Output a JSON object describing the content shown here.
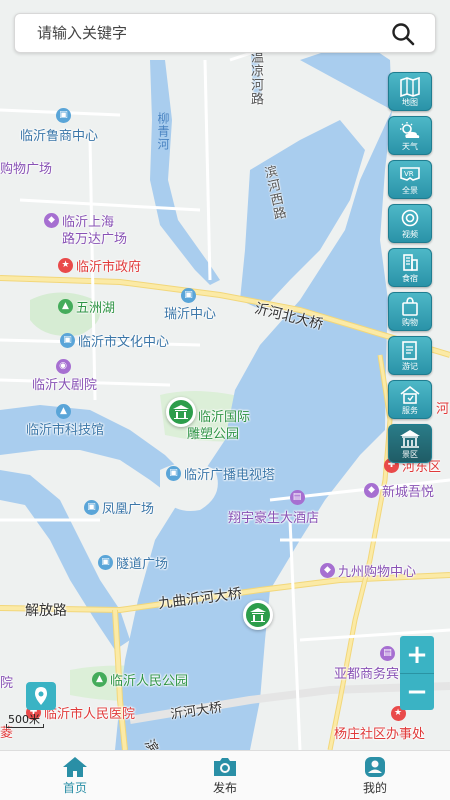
{
  "search": {
    "placeholder": "请输入关键字"
  },
  "map": {
    "pois": [
      {
        "name": "临沂鲁商中心",
        "color": "blue"
      },
      {
        "name": "购物广场",
        "color": "purple"
      },
      {
        "name": "临沂上海",
        "color": "purple"
      },
      {
        "name": "路万达广场",
        "color": "purple"
      },
      {
        "name": "临沂市政府",
        "color": "red"
      },
      {
        "name": "五洲湖",
        "color": "green"
      },
      {
        "name": "瑞沂中心",
        "color": "blue"
      },
      {
        "name": "临沂市文化中心",
        "color": "blue"
      },
      {
        "name": "临沂大剧院",
        "color": "purple"
      },
      {
        "name": "临沂市科技馆",
        "color": "blue"
      },
      {
        "name": "临沂国际",
        "color": "green"
      },
      {
        "name": "雕塑公园",
        "color": "green"
      },
      {
        "name": "临沂广播电视塔",
        "color": "blue"
      },
      {
        "name": "凤凰广场",
        "color": "blue"
      },
      {
        "name": "翔宇豪生大酒店",
        "color": "purple"
      },
      {
        "name": "隧道广场",
        "color": "blue"
      },
      {
        "name": "河东区",
        "color": "red"
      },
      {
        "name": "新城吾悦",
        "color": "purple"
      },
      {
        "name": "九州购物中心",
        "color": "purple"
      },
      {
        "name": "临沂人民公园",
        "color": "green"
      },
      {
        "name": "亚都商务宾馆",
        "color": "purple"
      },
      {
        "name": "临沂市人民医院",
        "color": "red"
      },
      {
        "name": "杨庄社区办事处",
        "color": "red"
      }
    ],
    "roads": {
      "wenliang": "温凉河路",
      "liuqing": "柳青河",
      "binhe_west": "滨河西路",
      "yihe_north_bridge": "沂河北大桥",
      "jiefang": "解放路",
      "jiuqu_bridge": "九曲沂河大桥",
      "yihe_bridge": "沂河大桥",
      "edge_he": "河",
      "edge_yuan": "院",
      "edge_ling": "菱",
      "edge_bin": "滨"
    },
    "scale_label": "500米"
  },
  "side_tools": [
    {
      "label": "地图",
      "icon": "map-icon"
    },
    {
      "label": "天气",
      "icon": "weather-icon"
    },
    {
      "label": "全景",
      "icon": "vr-icon"
    },
    {
      "label": "视频",
      "icon": "video-icon"
    },
    {
      "label": "食宿",
      "icon": "hotel-icon"
    },
    {
      "label": "购物",
      "icon": "shopping-icon"
    },
    {
      "label": "游记",
      "icon": "notes-icon"
    },
    {
      "label": "服务",
      "icon": "service-icon"
    },
    {
      "label": "景区",
      "icon": "scenic-icon"
    }
  ],
  "zoom": {
    "in": "+",
    "out": "−"
  },
  "bottom_nav": [
    {
      "label": "首页",
      "icon": "home-icon",
      "active": true
    },
    {
      "label": "发布",
      "icon": "camera-icon",
      "active": false
    },
    {
      "label": "我的",
      "icon": "user-icon",
      "active": false
    }
  ],
  "colors": {
    "accent": "#2a8fa6",
    "water": "#a9cdee",
    "land": "#eef1f0",
    "major_road": "#f7e39a"
  }
}
